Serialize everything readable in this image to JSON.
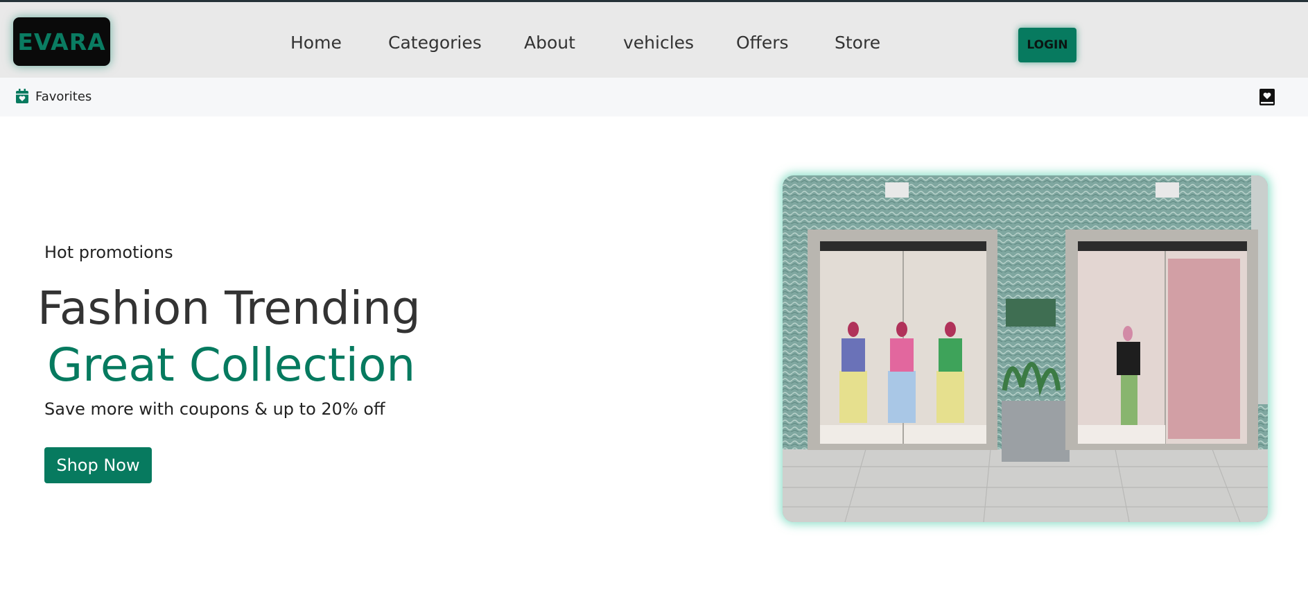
{
  "header": {
    "logo": "EVARA",
    "nav": [
      "Home",
      "Categories",
      "About",
      "vehicles",
      "Offers",
      "Store"
    ],
    "login_label": "LOGIN"
  },
  "subbar": {
    "favorites_label": "Favorites",
    "favorites_icon": "calendar-heart-icon",
    "right_icon": "book-heart-icon"
  },
  "hero": {
    "tag": "Hot promotions",
    "title": "Fashion Trending",
    "subtitle": "Great Collection",
    "description": "Save more with coupons & up to 20% off",
    "cta_label": "Shop Now",
    "image": "storefront-photo"
  },
  "colors": {
    "accent": "#077a5f",
    "header_bg": "#e9e9e9",
    "subbar_bg": "#f6f7f9",
    "logo_bg": "#0a0a0a"
  }
}
